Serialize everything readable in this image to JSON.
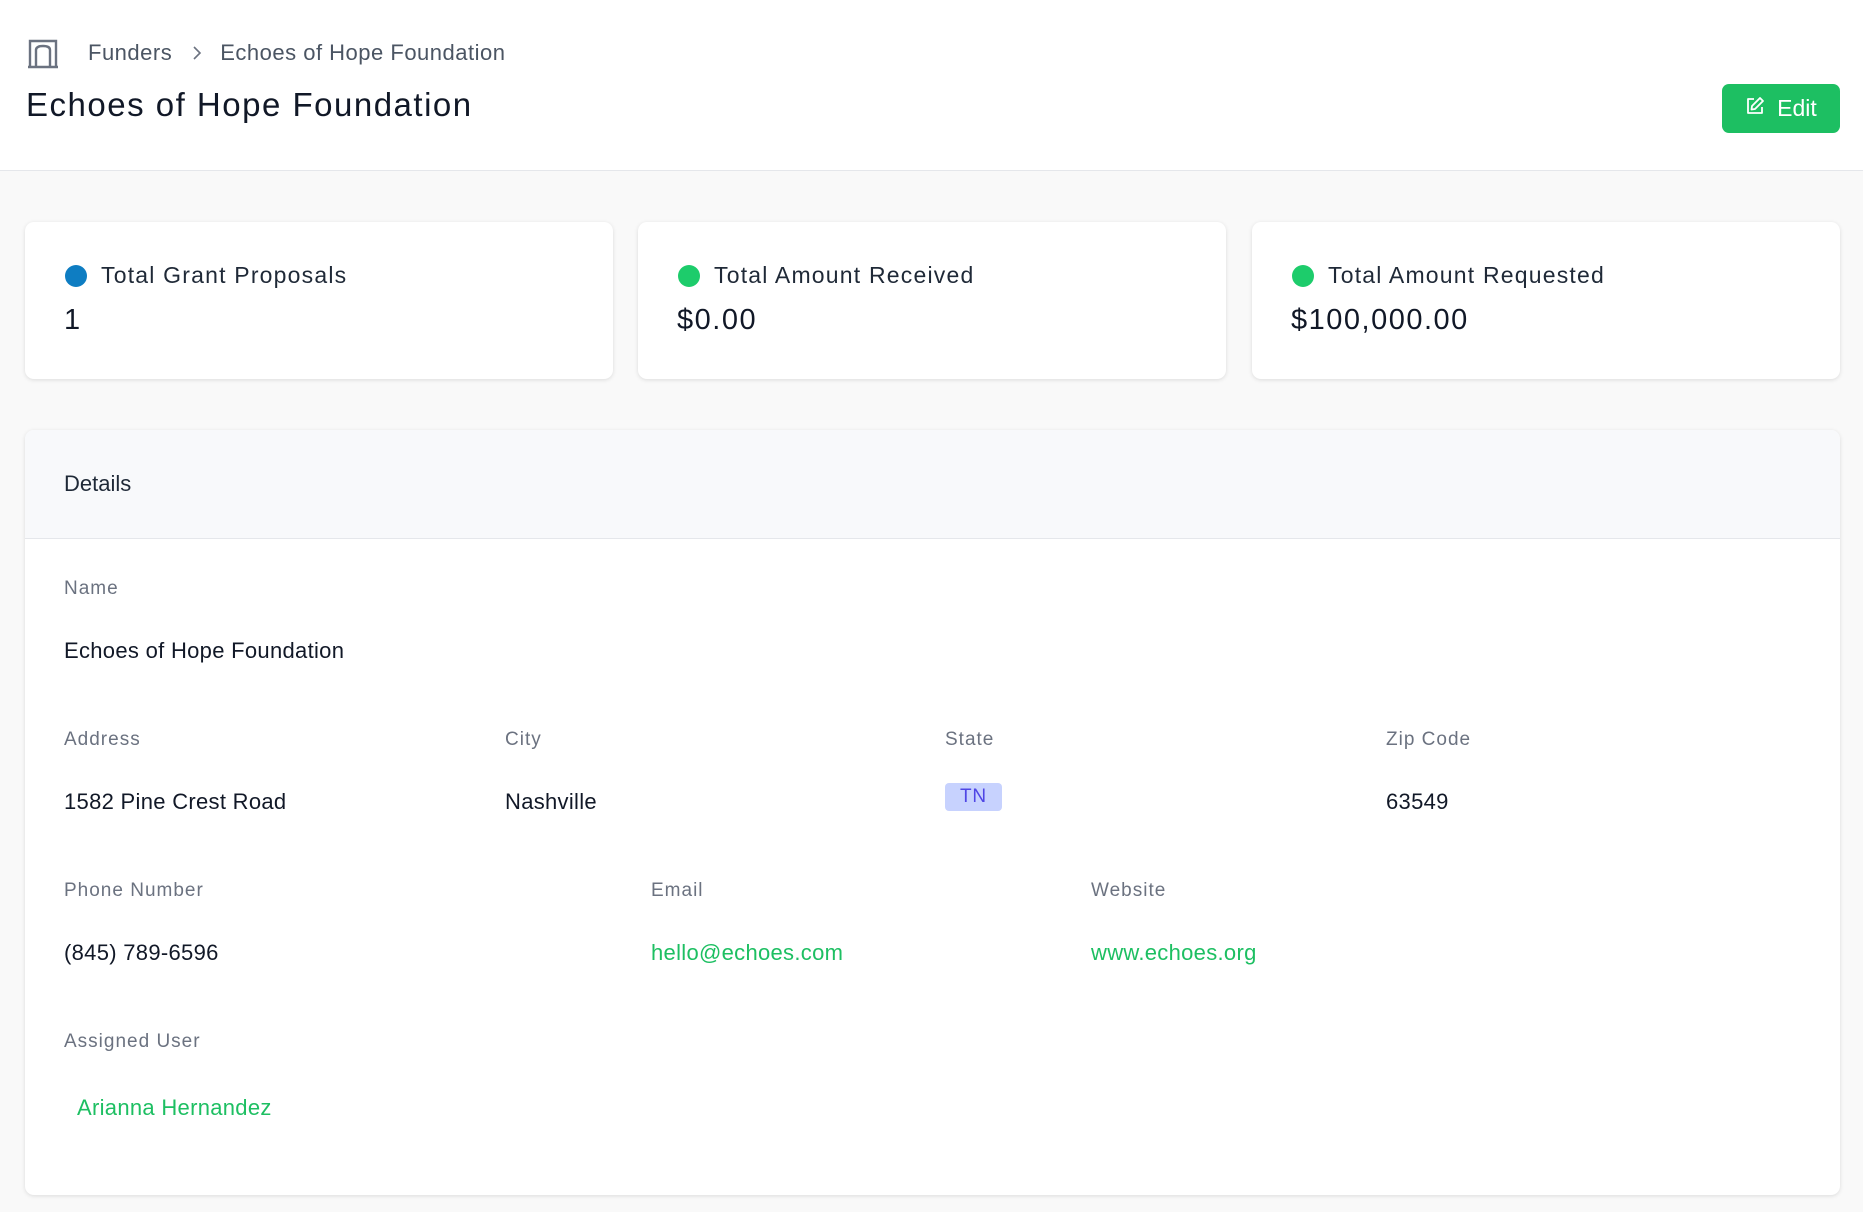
{
  "breadcrumb": {
    "home_icon": "building-icon",
    "parent": "Funders",
    "separator_icon": "chevron-right-icon",
    "current": "Echoes of Hope Foundation"
  },
  "page": {
    "title": "Echoes of Hope Foundation",
    "edit_label": "Edit",
    "edit_icon": "edit-icon"
  },
  "stats": [
    {
      "label": "Total Grant Proposals",
      "value": "1",
      "color": "#0e7dc2"
    },
    {
      "label": "Total Amount Received",
      "value": "$0.00",
      "color": "#1dcc6b"
    },
    {
      "label": "Total Amount Requested",
      "value": "$100,000.00",
      "color": "#1dcc6b"
    }
  ],
  "details": {
    "heading": "Details",
    "name": {
      "label": "Name",
      "value": "Echoes of Hope Foundation"
    },
    "address": {
      "label": "Address",
      "value": "1582 Pine Crest Road"
    },
    "city": {
      "label": "City",
      "value": "Nashville"
    },
    "state": {
      "label": "State",
      "value": "TN"
    },
    "zip": {
      "label": "Zip Code",
      "value": "63549"
    },
    "phone": {
      "label": "Phone Number",
      "value": "(845) 789-6596"
    },
    "email": {
      "label": "Email",
      "value": "hello@echoes.com"
    },
    "website": {
      "label": "Website",
      "value": "www.echoes.org"
    },
    "assigned_user": {
      "label": "Assigned User",
      "value": "Arianna Hernandez"
    }
  },
  "colors": {
    "accent": "#1dbf62",
    "badge_bg": "#c7d2fe",
    "badge_text": "#4f46e5"
  }
}
